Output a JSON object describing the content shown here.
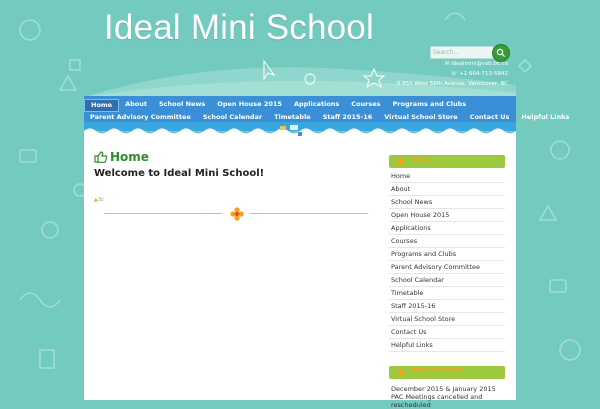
{
  "site": {
    "title": "Ideal Mini School"
  },
  "search": {
    "placeholder": "Search..."
  },
  "contact": {
    "email": "idealmini@vsb.bc.ca",
    "phone": "+1 604-713-5842",
    "address": "855 West 59th Avenue, Vancouver, BC"
  },
  "nav": {
    "row1": [
      "Home",
      "About",
      "School News",
      "Open House 2015",
      "Applications",
      "Courses",
      "Programs and Clubs"
    ],
    "row2": [
      "Parent Advisory Committee",
      "School Calendar",
      "Timetable",
      "Staff 2015-16",
      "Virtual School Store",
      "Contact Us",
      "Helpful Links"
    ]
  },
  "main": {
    "page_title": "Home",
    "welcome": "Welcome to Ideal Mini School!",
    "author_label": "3c"
  },
  "sidebar": {
    "pages_heading": "PAGES",
    "pages": [
      "Home",
      "About",
      "School News",
      "Open House 2015",
      "Applications",
      "Courses",
      "Programs and Clubs",
      "Parent Advisory Committee",
      "School Calendar",
      "Timetable",
      "Staff 2015-16",
      "Virtual School Store",
      "Contact Us",
      "Helpful Links"
    ],
    "recent_heading": "RECENT POSTS",
    "recent_post": "December 2015 & January 2015 PAC Meetings cancelled and rescheduled"
  },
  "colors": {
    "background": "#73cbc0",
    "nav_blue": "#3a8fd6",
    "title_green": "#2e8b2e",
    "sidebar_header_green": "#9cc93d",
    "sidebar_header_text": "#f7a11a"
  }
}
